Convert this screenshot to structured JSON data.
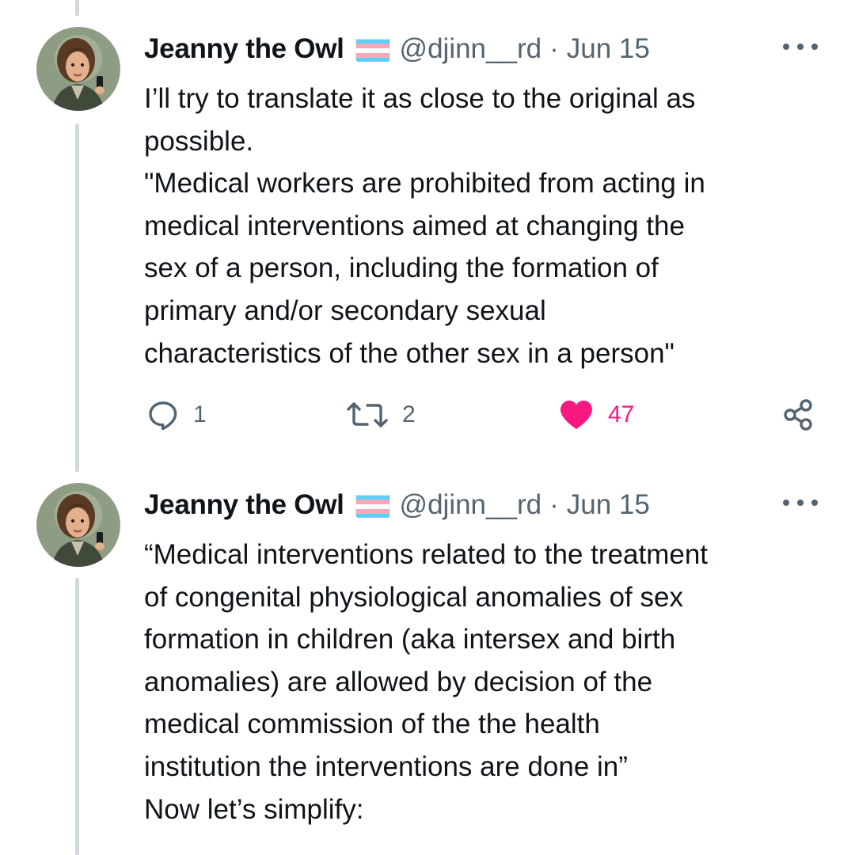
{
  "tweets": [
    {
      "author": {
        "display_name": "Jeanny the Owl",
        "handle": "@djinn__rd",
        "flag_icon": "transgender-flag-icon",
        "avatar_icon": "avatar-illustration"
      },
      "separator": "·",
      "date": "Jun 15",
      "more_icon": "more-icon",
      "lines": [
        "I’ll try to translate it as close to the original as",
        "possible.",
        "\"Medical workers are prohibited from acting in",
        "medical interventions aimed at changing the",
        "sex of a person, including the formation of",
        "primary and/or secondary sexual",
        "characteristics of the other sex in a person\""
      ],
      "actions": {
        "reply_count": "1",
        "retweet_count": "2",
        "like_count": "47",
        "liked": true
      }
    },
    {
      "author": {
        "display_name": "Jeanny the Owl",
        "handle": "@djinn__rd",
        "flag_icon": "transgender-flag-icon",
        "avatar_icon": "avatar-illustration"
      },
      "separator": "·",
      "date": "Jun 15",
      "more_icon": "more-icon",
      "lines": [
        "“Medical interventions related to the treatment",
        "of congenital physiological anomalies of sex",
        "formation in children (aka intersex and birth",
        "anomalies) are allowed by decision of the",
        "medical commission of the the health",
        "institution the interventions are done in”",
        "Now let’s simplify:"
      ]
    }
  ],
  "colors": {
    "text_primary": "#0f1419",
    "text_secondary": "#536471",
    "like_pink": "#f91880",
    "thread_line": "#cfd9de",
    "flag_blue": "#5bcefa",
    "flag_pink": "#f5a9b8",
    "flag_white": "#ffffff"
  }
}
